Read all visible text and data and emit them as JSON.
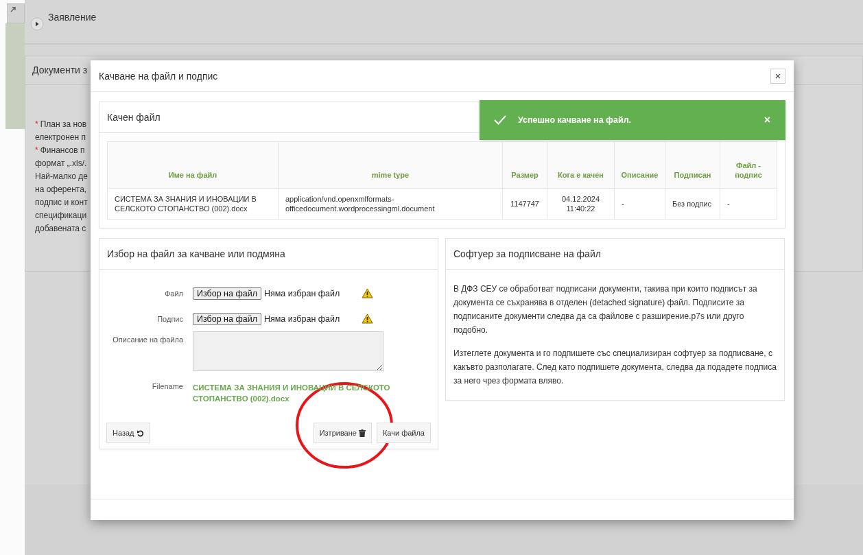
{
  "background": {
    "section": {
      "title": "Заявление"
    },
    "documents": {
      "title": "Документи з",
      "lines": [
        {
          "marker": "*",
          "text": "План за нов"
        },
        {
          "text": "електронен п"
        },
        {
          "marker": "*",
          "text": "Финансов п"
        },
        {
          "text": "формат „.xls/."
        },
        {
          "text": "Най-малко де"
        },
        {
          "text": "на оферента,"
        },
        {
          "text": "подпис и конт"
        },
        {
          "text": "спецификаци"
        },
        {
          "text": "добавената с"
        }
      ]
    }
  },
  "modal": {
    "title": "Качване на файл и подпис",
    "close": "×",
    "toast": {
      "message": "Успешно качване на файл.",
      "close": "×"
    },
    "uploaded": {
      "title": "Качен файл",
      "columns": [
        "Име на файл",
        "mime type",
        "Размер",
        "Кога е качен",
        "Описание",
        "Подписан",
        "Файл - подпис"
      ],
      "rows": [
        [
          "СИСТЕМА ЗА ЗНАНИЯ И ИНОВАЦИИ В СЕЛСКОТО СТОПАНСТВО (002).docx",
          "application/vnd.openxmlformats-officedocument.wordprocessingml.document",
          "1147747",
          "04.12.2024 11:40:22",
          "-",
          "Без подпис",
          "-"
        ]
      ]
    },
    "form": {
      "title": "Избор на файл за качване или подмяна",
      "fields": [
        {
          "kind": "file",
          "label": "Файл",
          "button": "Избор на файл",
          "status": "Няма избран файл",
          "warning": true
        },
        {
          "kind": "file",
          "label": "Подпис",
          "button": "Избор на файл",
          "status": "Няма избран файл",
          "warning": true
        },
        {
          "kind": "textarea",
          "label": "Описание на файла"
        },
        {
          "kind": "filename",
          "label": "Filename",
          "value": "СИСТЕМА ЗА ЗНАНИЯ И ИНОВАЦИИ В СЕЛСКОТО СТОПАНСТВО (002).docx"
        }
      ],
      "buttons": [
        {
          "kind": "back",
          "label": "Назад"
        },
        {
          "kind": "delete",
          "label": "Изтриване"
        },
        {
          "kind": "upload",
          "label": "Качи файла"
        }
      ]
    },
    "info": {
      "title": "Софтуер за подписване на файл",
      "paragraphs": [
        "В ДФЗ СЕУ се обработват подписани документи, такива при които подписът за документа се съхранява в отделен (detached signature) файл. Подписите за подписаните документи следва да са файлове с разширение.p7s или друго подобно.",
        "Изтеглете документа и го подпишете със специализиран софтуер за подписване, с какъвто разполагате. След като подпишете документа, следва да подадете подписа за него чрез формата вляво."
      ]
    }
  },
  "annotations": [
    {
      "kind": "circle",
      "color": "#e8161b"
    }
  ]
}
